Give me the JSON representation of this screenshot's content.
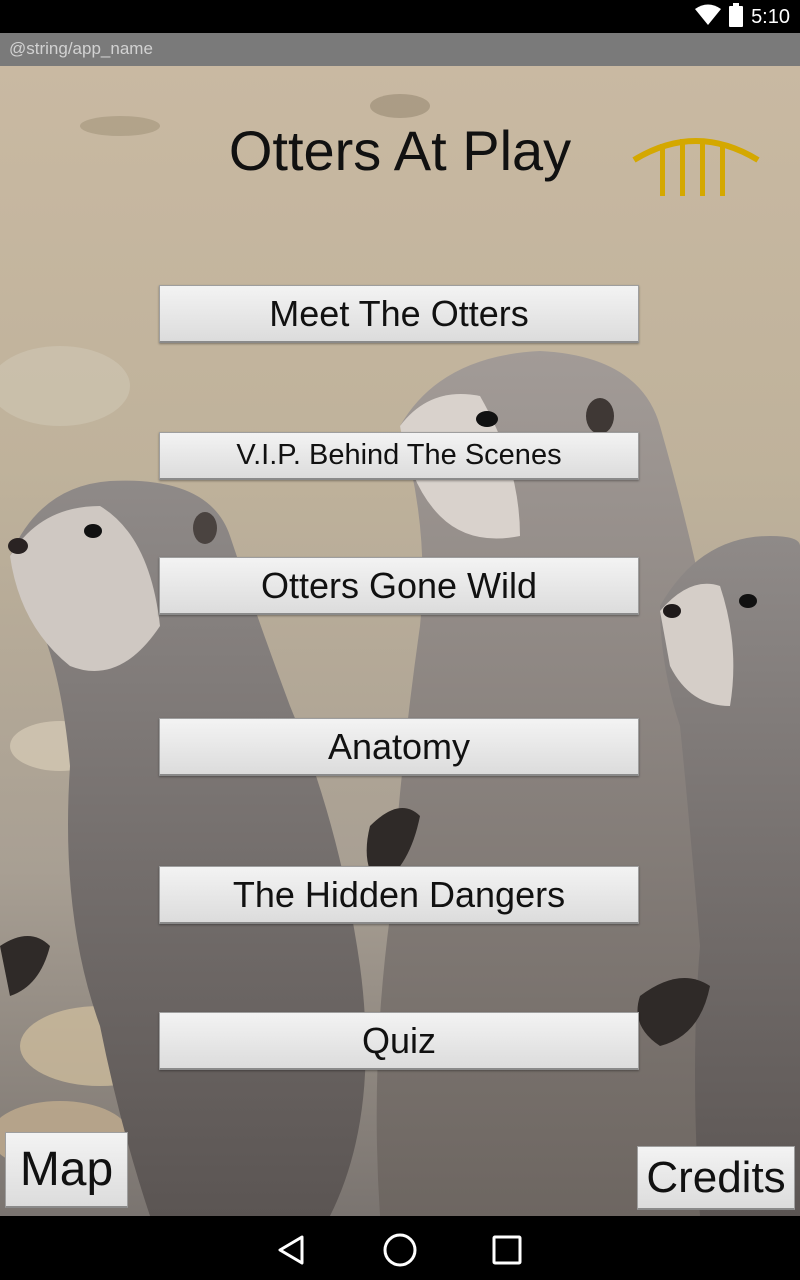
{
  "status_bar": {
    "time": "5:10",
    "icons": [
      "wifi-icon",
      "battery-icon"
    ]
  },
  "app_bar": {
    "title": "@string/app_name"
  },
  "main": {
    "title": "Otters At Play",
    "logo_icon": "bridge-logo-icon",
    "menu": [
      {
        "label": "Meet The Otters"
      },
      {
        "label": "V.I.P. Behind The Scenes"
      },
      {
        "label": "Otters Gone Wild"
      },
      {
        "label": "Anatomy"
      },
      {
        "label": "The Hidden Dangers"
      },
      {
        "label": "Quiz"
      }
    ],
    "map_label": "Map",
    "credits_label": "Credits"
  },
  "nav_bar": {
    "icons": [
      "back-icon",
      "home-icon",
      "recents-icon"
    ]
  },
  "colors": {
    "status_bar": "#000000",
    "app_bar": "#7a7a7a",
    "button_face": "#e6e6e6",
    "logo_gold": "#d4a800"
  }
}
